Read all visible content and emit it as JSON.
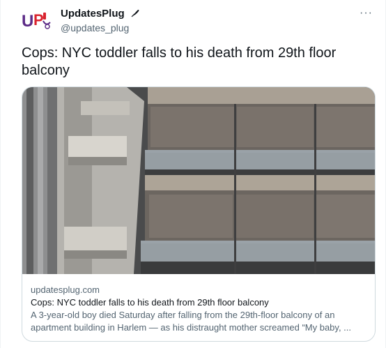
{
  "author": {
    "display_name": "UpdatesPlug",
    "handle": "@updates_plug",
    "avatar_text": "UP",
    "badge_icon": "feather-icon"
  },
  "more_label": "···",
  "tweet_text": "Cops: NYC toddler falls to his death from 29th floor balcony",
  "card": {
    "domain": "updatesplug.com",
    "title": "Cops: NYC toddler falls to his death from 29th floor balcony",
    "description_line1": "A 3-year-old boy died Saturday after falling from the 29th-floor balcony of an",
    "description_line2": "apartment building in Harlem — as his distraught mother screamed “My baby, ..."
  },
  "colors": {
    "accent": "#1d9bf0",
    "secondary_text": "#536471",
    "border": "#cfd9de",
    "avatar_purple": "#5b2a86",
    "avatar_red": "#d9232e"
  }
}
